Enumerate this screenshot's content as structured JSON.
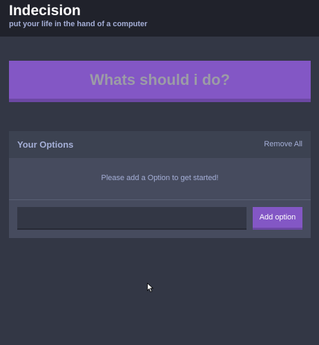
{
  "header": {
    "title": "Indecision",
    "subtitle": "put your life in the hand of a computer"
  },
  "action": {
    "label": "Whats should i do?"
  },
  "options": {
    "title": "Your Options",
    "remove_all_label": "Remove All",
    "empty_message": "Please add a Option to get started!",
    "input_value": "",
    "input_placeholder": "",
    "add_label": "Add option"
  },
  "colors": {
    "background": "#333745",
    "header": "#20222b",
    "accent": "#8357c5",
    "text_muted": "#a5afd7"
  },
  "icons": {
    "cursor": "mouse-pointer-icon"
  }
}
